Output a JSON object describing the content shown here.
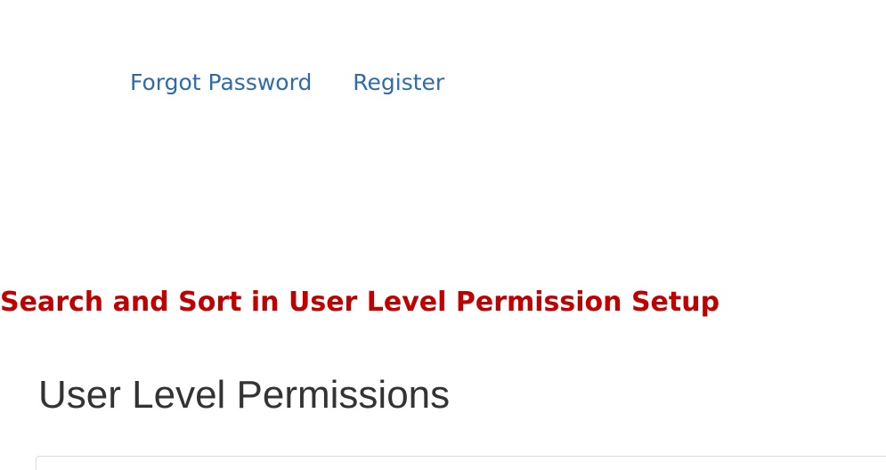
{
  "links": {
    "forgot_password": "Forgot Password",
    "register": "Register"
  },
  "section_heading": "Search and Sort in User Level Permission Setup",
  "page_title": "User Level Permissions",
  "colors": {
    "link": "#2f6bab",
    "heading": "#c00000",
    "title": "#333333",
    "panel_border": "#dddddd"
  }
}
